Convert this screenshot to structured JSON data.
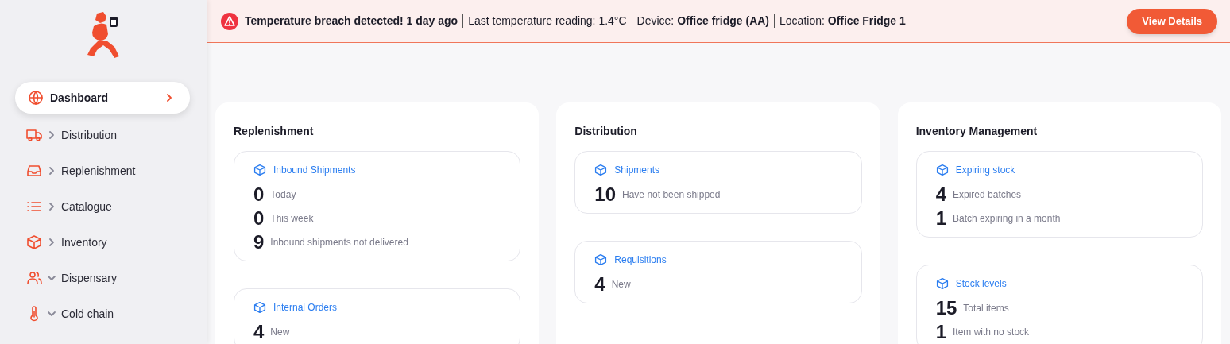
{
  "alert": {
    "parts": [
      {
        "kind": "headline",
        "text": "Temperature breach detected! 1 day ago"
      },
      {
        "kind": "detail",
        "text": "Last temperature reading: 1.4°C"
      },
      {
        "kind": "detail",
        "text": "Device: **Office fridge (AA)**"
      },
      {
        "kind": "detail",
        "text": "Location: **Office Fridge 1**"
      }
    ],
    "button": "View Details"
  },
  "sidebar": {
    "items": [
      {
        "label": "Dashboard",
        "expanded": false,
        "selected": true
      },
      {
        "label": "Distribution",
        "expanded": false,
        "selected": false
      },
      {
        "label": "Replenishment",
        "expanded": false,
        "selected": false
      },
      {
        "label": "Catalogue",
        "expanded": false,
        "selected": false
      },
      {
        "label": "Inventory",
        "expanded": false,
        "selected": false
      },
      {
        "label": "Dispensary",
        "expanded": true,
        "selected": false
      },
      {
        "label": "Cold chain",
        "expanded": true,
        "selected": false
      }
    ]
  },
  "sections": [
    {
      "title": "Replenishment",
      "widgets": [
        {
          "title": "Inbound Shipments",
          "stats": [
            {
              "value": "0",
              "label": "Today"
            },
            {
              "value": "0",
              "label": "This week"
            },
            {
              "value": "9",
              "label": "Inbound shipments not delivered"
            }
          ]
        },
        {
          "title": "Internal Orders",
          "stats": [
            {
              "value": "4",
              "label": "New"
            }
          ]
        }
      ]
    },
    {
      "title": "Distribution",
      "widgets": [
        {
          "title": "Shipments",
          "stats": [
            {
              "value": "10",
              "label": "Have not been shipped"
            }
          ]
        },
        {
          "title": "Requisitions",
          "stats": [
            {
              "value": "4",
              "label": "New"
            }
          ]
        }
      ]
    },
    {
      "title": "Inventory Management",
      "widgets": [
        {
          "title": "Expiring stock",
          "stats": [
            {
              "value": "4",
              "label": "Expired batches"
            },
            {
              "value": "1",
              "label": "Batch expiring in a month"
            }
          ]
        },
        {
          "title": "Stock levels",
          "stats": [
            {
              "value": "15",
              "label": "Total items"
            },
            {
              "value": "1",
              "label": "Item with no stock"
            }
          ]
        }
      ]
    }
  ]
}
